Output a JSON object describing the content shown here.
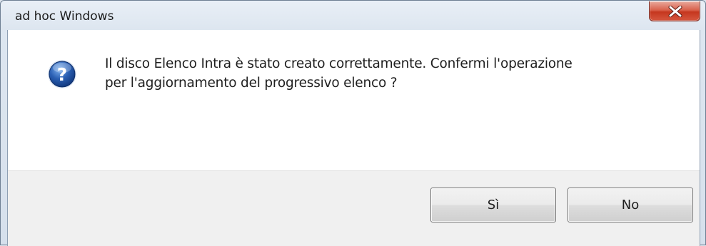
{
  "window": {
    "title": "ad hoc Windows"
  },
  "dialog": {
    "icon": "question-icon",
    "message_lines": [
      "Il disco Elenco Intra è stato creato correttamente. Confermi l'operazione",
      "per l'aggiornamento del progressivo elenco ?"
    ]
  },
  "buttons": {
    "yes_label": "Sì",
    "no_label": "No"
  },
  "colors": {
    "close_button": "#d6573f",
    "icon_blue": "#2a5fb3",
    "button_bar": "#f0f0f0"
  }
}
